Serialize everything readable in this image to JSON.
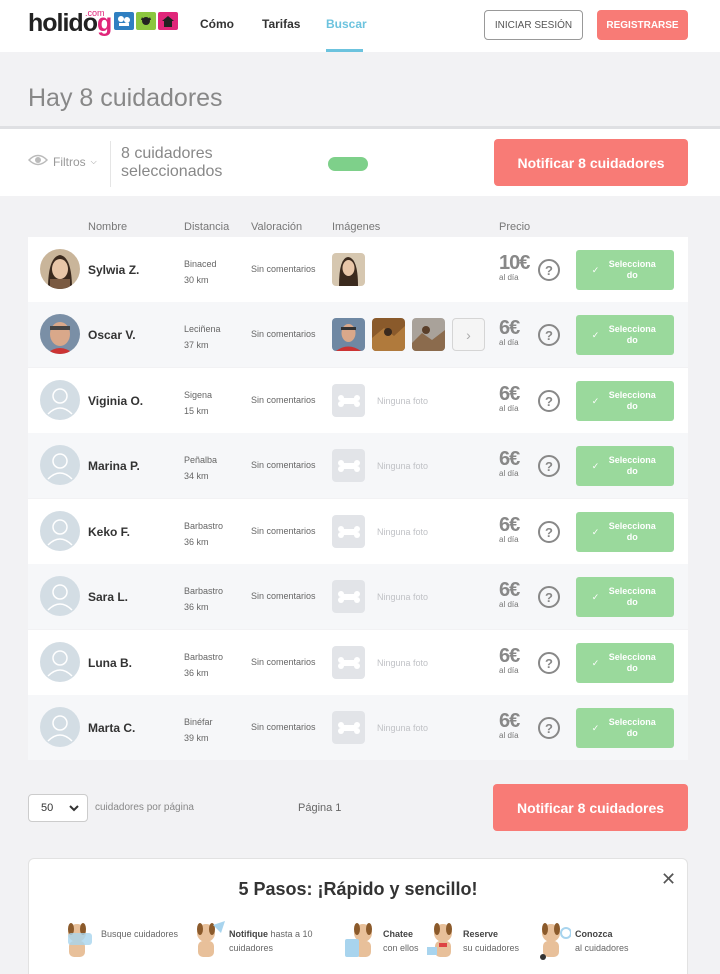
{
  "header": {
    "logo_main": "holido",
    "logo_g": "g",
    "logo_com": ".com",
    "nav": [
      "Cómo",
      "Tarifas",
      "Buscar"
    ],
    "login_label": "INICIAR SESIÓN",
    "register_label": "REGISTRARSE"
  },
  "page_title": "Hay 8 cuidadores",
  "filter_bar": {
    "filters_label": "Filtros",
    "selected_line1": "8 cuidadores",
    "selected_line2": "seleccionados",
    "notify_label": "Notificar 8 cuidadores"
  },
  "table": {
    "columns": [
      "Nombre",
      "Distancia",
      "Valoración",
      "Imágenes",
      "Precio"
    ],
    "rows": [
      {
        "name": "Sylwia Z.",
        "city": "Binaced",
        "distance": "30 km",
        "rating": "Sin comentarios",
        "price": "10€",
        "unit": "al día",
        "select": "Selecciona do",
        "no_photo": ""
      },
      {
        "name": "Oscar V.",
        "city": "Leciñena",
        "distance": "37 km",
        "rating": "Sin comentarios",
        "price": "6€",
        "unit": "al día",
        "select": "Selecciona do",
        "no_photo": ""
      },
      {
        "name": "Viginia O.",
        "city": "Sigena",
        "distance": "15 km",
        "rating": "Sin comentarios",
        "price": "6€",
        "unit": "al día",
        "select": "Selecciona do",
        "no_photo": "Ninguna foto"
      },
      {
        "name": "Marina P.",
        "city": "Peñalba",
        "distance": "34 km",
        "rating": "Sin comentarios",
        "price": "6€",
        "unit": "al día",
        "select": "Selecciona do",
        "no_photo": "Ninguna foto"
      },
      {
        "name": "Keko F.",
        "city": "Barbastro",
        "distance": "36 km",
        "rating": "Sin comentarios",
        "price": "6€",
        "unit": "al día",
        "select": "Selecciona do",
        "no_photo": "Ninguna foto"
      },
      {
        "name": "Sara L.",
        "city": "Barbastro",
        "distance": "36 km",
        "rating": "Sin comentarios",
        "price": "6€",
        "unit": "al día",
        "select": "Selecciona do",
        "no_photo": "Ninguna foto"
      },
      {
        "name": "Luna B.",
        "city": "Barbastro",
        "distance": "36 km",
        "rating": "Sin comentarios",
        "price": "6€",
        "unit": "al día",
        "select": "Selecciona do",
        "no_photo": "Ninguna foto"
      },
      {
        "name": "Marta C.",
        "city": "Binéfar",
        "distance": "39 km",
        "rating": "Sin comentarios",
        "price": "6€",
        "unit": "al día",
        "select": "Selecciona do",
        "no_photo": "Ninguna foto"
      }
    ]
  },
  "pagination": {
    "per_page_value": "50",
    "per_page_label": "cuidadores por página",
    "page_label": "Página 1",
    "notify_label": "Notificar 8 cuidadores"
  },
  "steps": {
    "title": "5 Pasos: ¡Rápido y sencillo!",
    "items": [
      {
        "bold": "",
        "line1": "Busque cuidadores",
        "line2": ""
      },
      {
        "bold": "Notifique",
        "line1": " hasta a 10",
        "line2": "cuidadores"
      },
      {
        "bold": "Chatee",
        "line1": "",
        "line2": "con ellos"
      },
      {
        "bold": "Reserve",
        "line1": "",
        "line2": "su cuidadores"
      },
      {
        "bold": "Conozca",
        "line1": "",
        "line2": "al cuidadores"
      }
    ]
  },
  "colors": {
    "accent": "#f87b76",
    "select_green": "#9ad99c",
    "nav_active": "#6cc3de"
  }
}
